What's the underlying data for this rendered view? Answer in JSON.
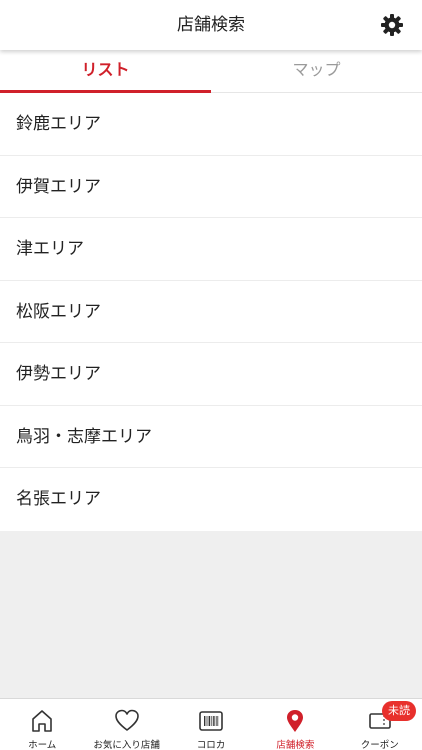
{
  "header": {
    "title": "店舗検索",
    "settings_icon": "gear-icon"
  },
  "tabs": [
    {
      "label": "リスト",
      "active": true
    },
    {
      "label": "マップ",
      "active": false
    }
  ],
  "areas": [
    "鈴鹿エリア",
    "伊賀エリア",
    "津エリア",
    "松阪エリア",
    "伊勢エリア",
    "鳥羽・志摩エリア",
    "名張エリア"
  ],
  "tabbar": {
    "items": [
      {
        "label": "ホーム",
        "icon": "home-icon",
        "active": false
      },
      {
        "label": "お気に入り店舗",
        "icon": "heart-icon",
        "active": false
      },
      {
        "label": "コロカ",
        "icon": "barcode-card-icon",
        "active": false
      },
      {
        "label": "店舗検索",
        "icon": "map-pin-icon",
        "active": true
      },
      {
        "label": "クーポン",
        "icon": "coupon-icon",
        "active": false
      }
    ],
    "coupon_badge": "未読"
  },
  "colors": {
    "accent": "#d0202a",
    "badge": "#e8302c",
    "background": "#efefef"
  }
}
